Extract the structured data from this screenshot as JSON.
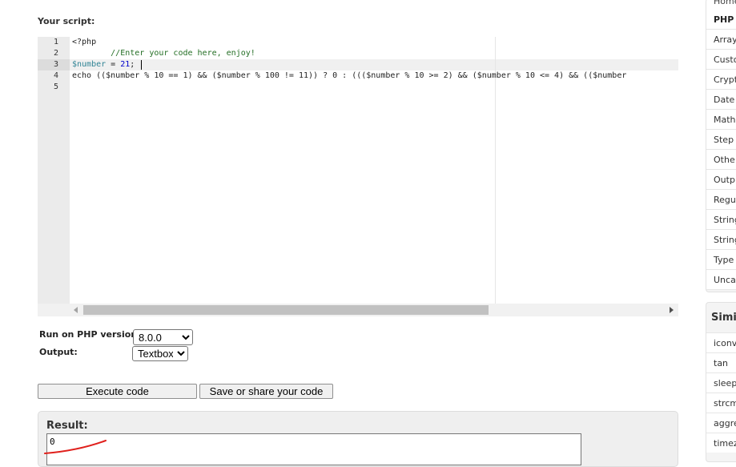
{
  "editor": {
    "label": "Your script:",
    "line_numbers": [
      "1",
      "2",
      "3",
      "4",
      "5"
    ],
    "lines": {
      "l1": "<?php",
      "l2": "        //Enter your code here, enjoy!",
      "l3_var": "$number",
      "l3_eq": " = ",
      "l3_num": "21",
      "l3_end": ";",
      "l4": "echo (($number % 10 == 1) && ($number % 100 != 11)) ? 0 : ((($number % 10 >= 2) && ($number % 10 <= 4) && (($number"
    }
  },
  "form": {
    "run_label": "Run on PHP version:",
    "php_version": "8.0.0",
    "output_label": "Output:",
    "output_mode": "Textbox",
    "execute_label": "Execute code",
    "save_label": "Save or share your code"
  },
  "result": {
    "label": "Result:",
    "value": "0"
  },
  "sidebar": {
    "items": [
      "Home",
      "PHP",
      "Array",
      "Custo",
      "Crypt",
      "Date",
      "Math",
      "Step",
      "Othe",
      "Outp",
      "Regu",
      "String",
      "String",
      "Type",
      "Uncal"
    ]
  },
  "similar": {
    "title": "Simil",
    "items": [
      "iconv",
      "tan",
      "sleep",
      "strcm",
      "aggre",
      "timez"
    ]
  },
  "colors": {
    "annotation": "#e0201c"
  }
}
